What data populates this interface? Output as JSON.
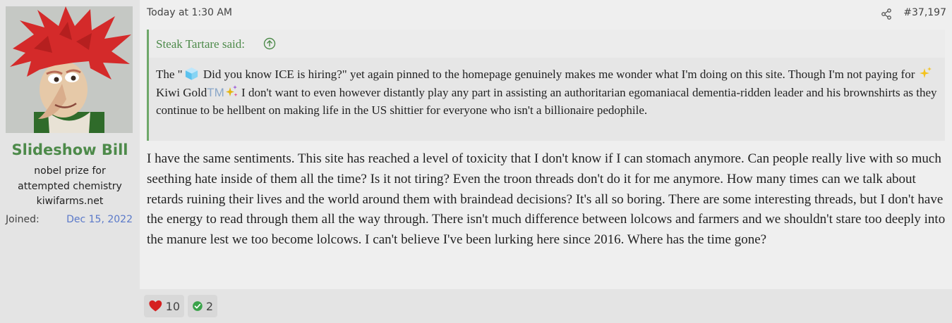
{
  "user": {
    "name": "Slideshow Bill",
    "title_line1": "nobel prize for",
    "title_line2": "attempted chemistry",
    "domain": "kiwifarms.net",
    "joined_label": "Joined:",
    "joined_date": "Dec 15, 2022",
    "avatar_icon": "avatar-image"
  },
  "post": {
    "date": "Today at 1:30 AM",
    "number": "#37,197",
    "share_icon": "share-icon"
  },
  "quote": {
    "author": "Steak Tartare said:",
    "text_a": "The \"",
    "text_b": " Did you know ICE is hiring?\" yet again pinned to the homepage genuinely makes me wonder what I'm doing on this site. Though I'm not paying for ",
    "kiwi_gold": "Kiwi Gold",
    "tm": "TM",
    "text_c": " I don't want to even however distantly play any part in assisting an authoritarian egomaniacal dementia-ridden leader and his brownshirts as they continue to be hellbent on making life in the US shittier for everyone who isn't a billionaire pedophile."
  },
  "message": {
    "text": "I have the same sentiments. This site has reached a level of toxicity that I don't know if I can stomach anymore. Can people really live with so much seething hate inside of them all the time? Is it not tiring? Even the troon threads don't do it for me anymore. How many times can we talk about retards ruining their lives and the world around them with braindead decisions? It's all so boring. There are some interesting threads, but I don't have the energy to read through them all the way through. There isn't much difference between lolcows and farmers and we shouldn't stare too deeply into the manure lest we too become lolcows. I can't believe I've been lurking here since 2016. Where has the time gone?"
  },
  "reactions": [
    {
      "icon": "heart-icon",
      "count": "10",
      "color": "#d52020"
    },
    {
      "icon": "checkmark-icon",
      "count": "2",
      "color": "#3aa34a"
    }
  ]
}
